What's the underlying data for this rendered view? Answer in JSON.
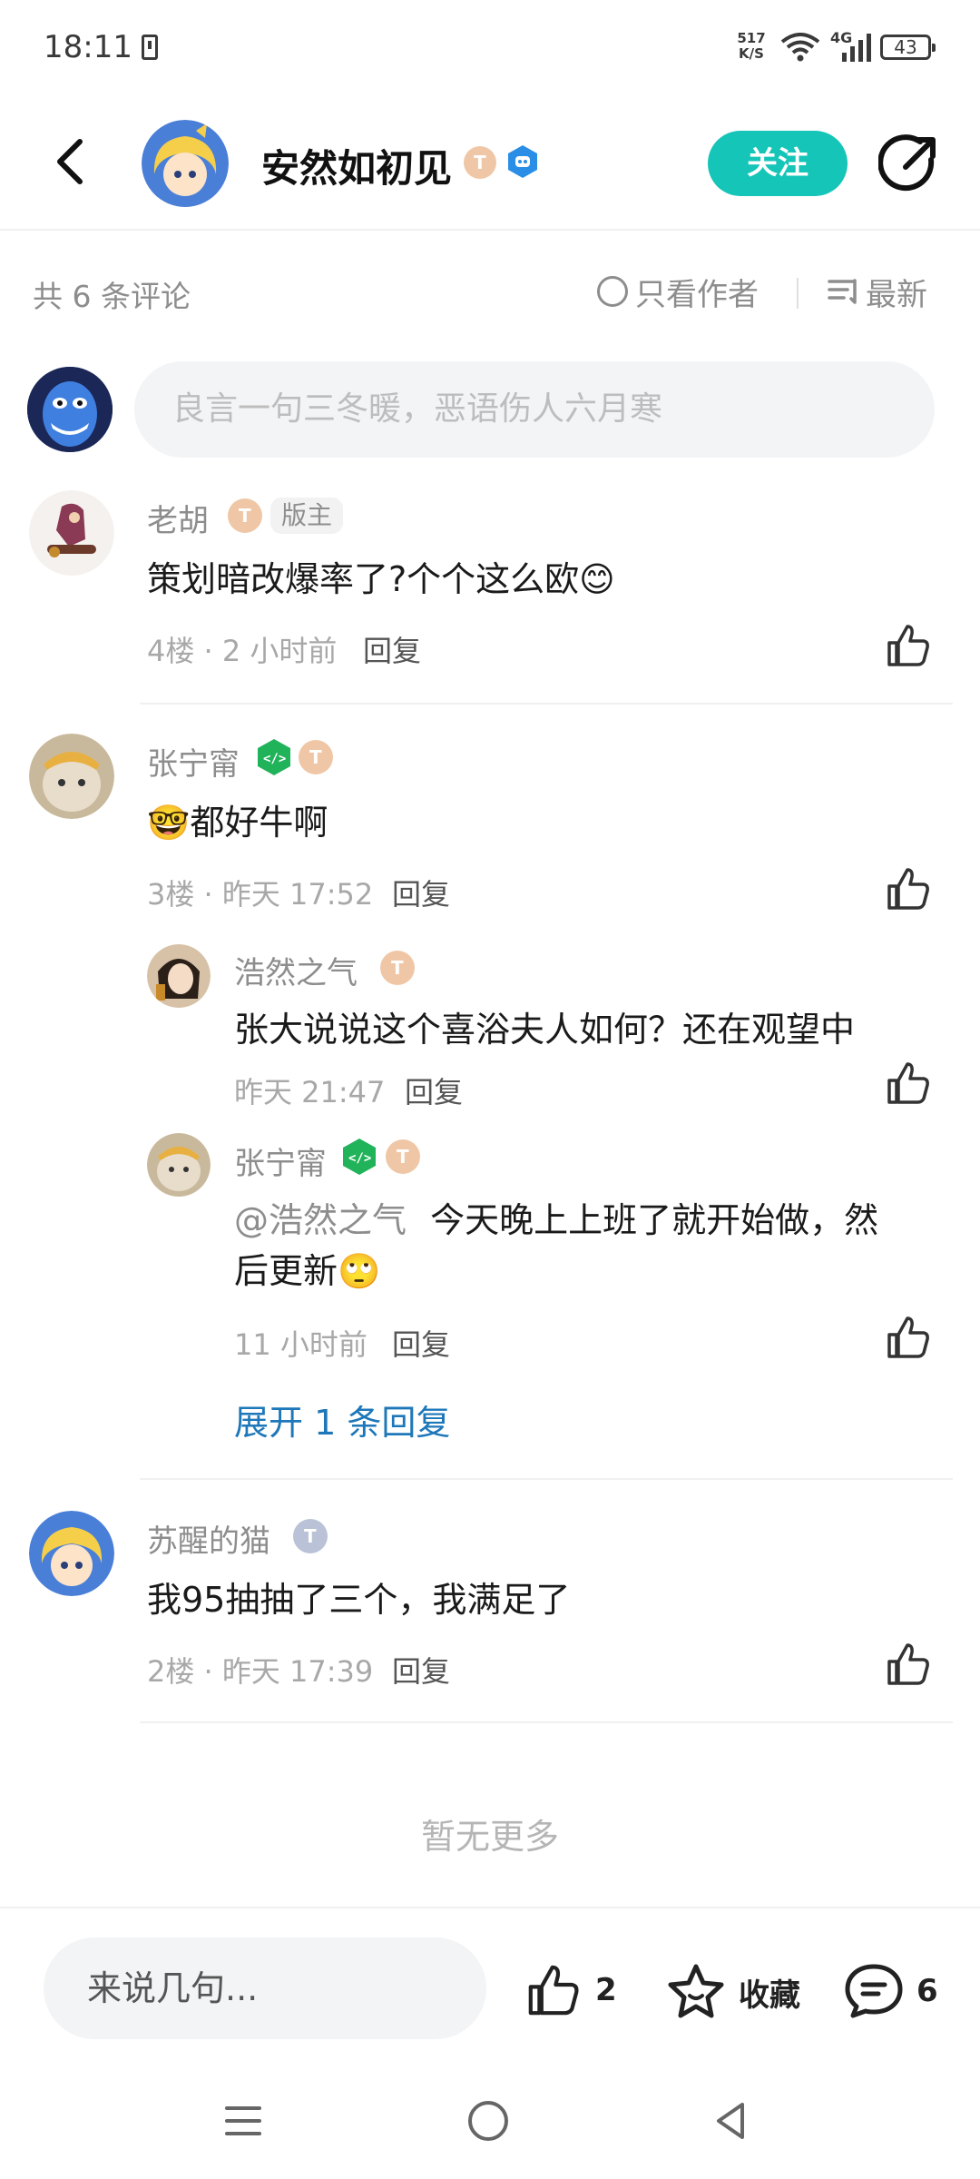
{
  "status_bar": {
    "time": "18:11",
    "net_speed_value": "517",
    "net_speed_unit": "K/S",
    "network": "4G",
    "battery": "43"
  },
  "header": {
    "author_name": "安然如初见",
    "follow_label": "关注"
  },
  "filter": {
    "comment_count": "共 6 条评论",
    "only_author_label": "只看作者",
    "sort_label": "最新"
  },
  "comment_input": {
    "placeholder": "良言一句三冬暖，恶语伤人六月寒"
  },
  "comments": [
    {
      "name": "老胡",
      "badge": "版主",
      "text": "策划暗改爆率了?个个这么欧😊",
      "floor_time": "4楼 · 2 小时前",
      "reply_label": "回复"
    },
    {
      "name": "张宁甯",
      "text": "🤓都好牛啊",
      "floor_time": "3楼 · 昨天 17:52",
      "reply_label": "回复",
      "replies": [
        {
          "name": "浩然之气",
          "text": "张大说说这个喜浴夫人如何？还在观望中",
          "time": "昨天 21:47",
          "reply_label": "回复"
        },
        {
          "name": "张宁甯",
          "mention": "@浩然之气",
          "text_line1": "今天晚上上班了就开始做，然",
          "text_line2": "后更新🙄",
          "time": "11 小时前",
          "reply_label": "回复"
        }
      ],
      "expand_label": "展开 1 条回复"
    },
    {
      "name": "苏醒的猫",
      "text": "我95抽抽了三个，我满足了",
      "floor_time": "2楼 · 昨天 17:39",
      "reply_label": "回复"
    }
  ],
  "no_more": "暂无更多",
  "bottom_bar": {
    "input_placeholder": "来说几句...",
    "like_count": "2",
    "favorite_label": "收藏",
    "comment_count": "6"
  },
  "colors": {
    "accent": "#15c5b8",
    "link": "#1d77b9",
    "muted_text": "#8d8d8d"
  }
}
